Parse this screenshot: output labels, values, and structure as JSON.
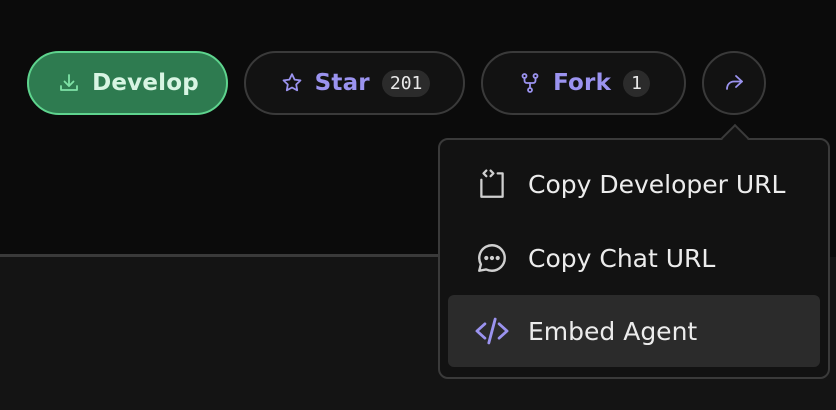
{
  "toolbar": {
    "develop_label": "Develop",
    "star_label": "Star",
    "star_count": "201",
    "fork_label": "Fork",
    "fork_count": "1"
  },
  "share_menu": {
    "items": [
      {
        "label": "Copy Developer URL",
        "icon": "code-bracket-icon"
      },
      {
        "label": "Copy Chat URL",
        "icon": "chat-bubble-icon"
      },
      {
        "label": "Embed Agent",
        "icon": "code-icon",
        "highlighted": true
      }
    ]
  },
  "colors": {
    "background": "#0b0b0b",
    "accent_purple": "#9b93ef",
    "develop_green": "#2e7b50",
    "develop_border": "#5ed48e"
  }
}
